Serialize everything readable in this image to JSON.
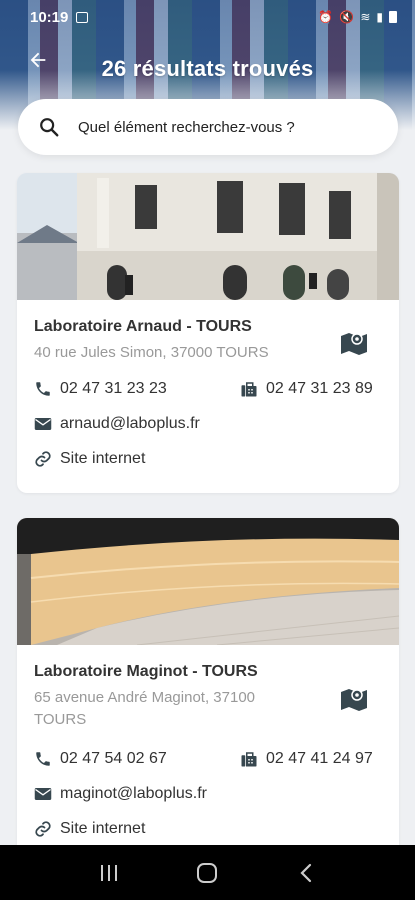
{
  "status_bar": {
    "time": "10:19"
  },
  "header": {
    "title": "26 résultats trouvés"
  },
  "search": {
    "placeholder": "Quel élément recherchez-vous ?"
  },
  "results": [
    {
      "name": "Laboratoire Arnaud - TOURS",
      "address": "40 rue Jules Simon, 37000 TOURS",
      "phone": "02 47 31 23 23",
      "fax": "02 47 31 23 89",
      "email": "arnaud@laboplus.fr",
      "website_label": "Site internet"
    },
    {
      "name": "Laboratoire Maginot - TOURS",
      "address": "65 avenue André Maginot, 37100 TOURS",
      "phone": "02 47 54 02 67",
      "fax": "02 47 41 24 97",
      "email": "maginot@laboplus.fr",
      "website_label": "Site internet"
    }
  ],
  "icons": {
    "back": "arrow-left-icon",
    "search": "search-icon",
    "map": "map-icon",
    "phone": "phone-icon",
    "fax": "fax-icon",
    "email": "envelope-icon",
    "link": "link-icon"
  },
  "colors": {
    "accent": "#37474f",
    "header_tint": "#3c6ea8"
  }
}
